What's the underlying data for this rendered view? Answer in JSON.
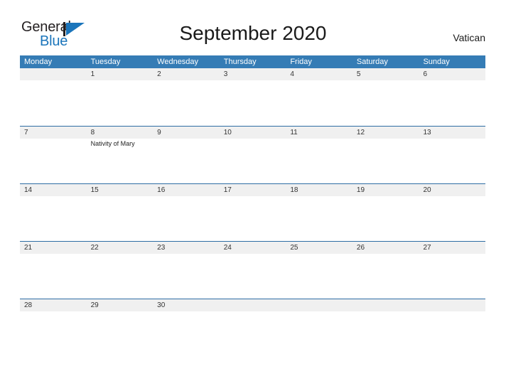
{
  "header": {
    "logo": {
      "text_top": "General",
      "text_bottom": "Blue",
      "mark": "flag-triangle"
    },
    "title": "September 2020",
    "locale": "Vatican"
  },
  "calendar": {
    "weekday_headers": [
      "Monday",
      "Tuesday",
      "Wednesday",
      "Thursday",
      "Friday",
      "Saturday",
      "Sunday"
    ],
    "colors": {
      "header_blue": "#357cb5",
      "divider_blue": "#2e6da4",
      "day_band_gray": "#f0f0f0",
      "logo_blue": "#1b75bb"
    },
    "weeks": [
      {
        "days": [
          {
            "num": "",
            "events": []
          },
          {
            "num": "1",
            "events": []
          },
          {
            "num": "2",
            "events": []
          },
          {
            "num": "3",
            "events": []
          },
          {
            "num": "4",
            "events": []
          },
          {
            "num": "5",
            "events": []
          },
          {
            "num": "6",
            "events": []
          }
        ]
      },
      {
        "days": [
          {
            "num": "7",
            "events": []
          },
          {
            "num": "8",
            "events": [
              "Nativity of Mary"
            ]
          },
          {
            "num": "9",
            "events": []
          },
          {
            "num": "10",
            "events": []
          },
          {
            "num": "11",
            "events": []
          },
          {
            "num": "12",
            "events": []
          },
          {
            "num": "13",
            "events": []
          }
        ]
      },
      {
        "days": [
          {
            "num": "14",
            "events": []
          },
          {
            "num": "15",
            "events": []
          },
          {
            "num": "16",
            "events": []
          },
          {
            "num": "17",
            "events": []
          },
          {
            "num": "18",
            "events": []
          },
          {
            "num": "19",
            "events": []
          },
          {
            "num": "20",
            "events": []
          }
        ]
      },
      {
        "days": [
          {
            "num": "21",
            "events": []
          },
          {
            "num": "22",
            "events": []
          },
          {
            "num": "23",
            "events": []
          },
          {
            "num": "24",
            "events": []
          },
          {
            "num": "25",
            "events": []
          },
          {
            "num": "26",
            "events": []
          },
          {
            "num": "27",
            "events": []
          }
        ]
      },
      {
        "days": [
          {
            "num": "28",
            "events": []
          },
          {
            "num": "29",
            "events": []
          },
          {
            "num": "30",
            "events": []
          },
          {
            "num": "",
            "events": []
          },
          {
            "num": "",
            "events": []
          },
          {
            "num": "",
            "events": []
          },
          {
            "num": "",
            "events": []
          }
        ]
      }
    ]
  }
}
